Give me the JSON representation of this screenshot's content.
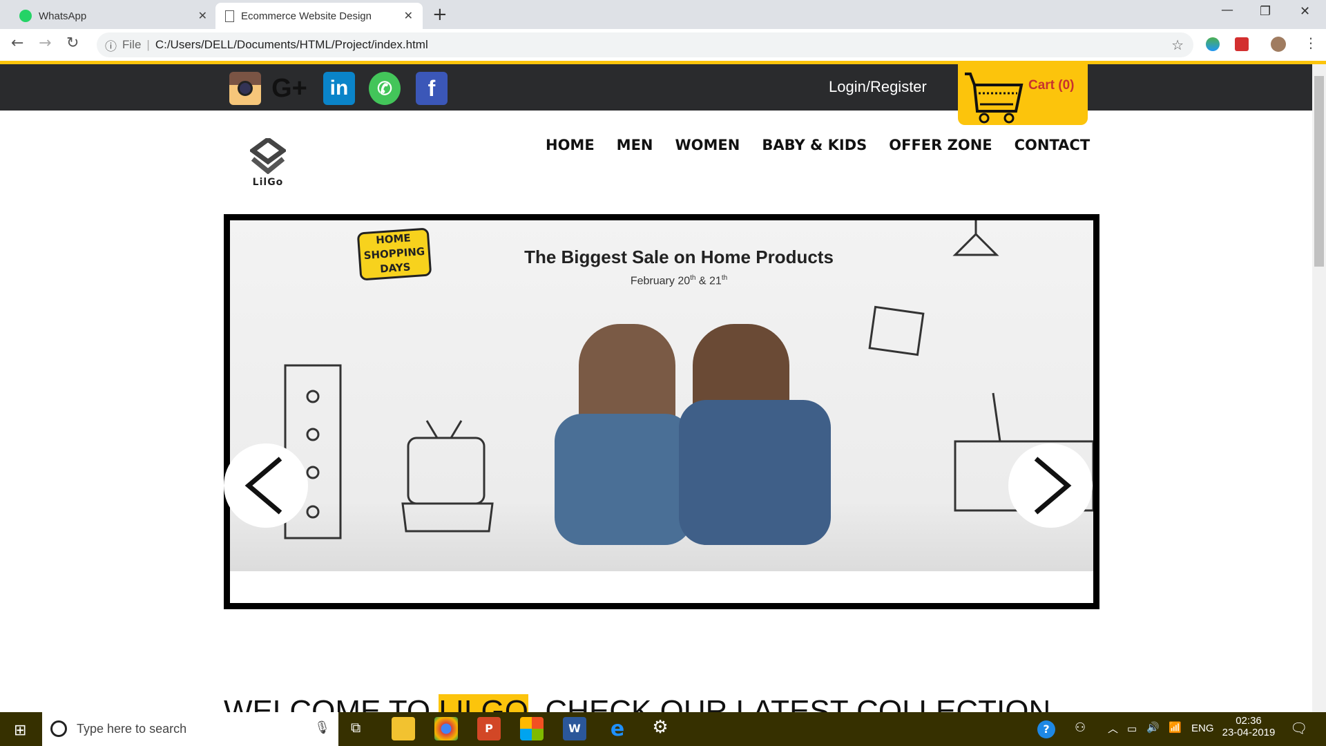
{
  "browser": {
    "tabs": [
      {
        "title": "WhatsApp",
        "icon": "whatsapp-icon"
      },
      {
        "title": "Ecommerce Website Design",
        "icon": "page-icon",
        "active": true
      }
    ],
    "address_prefix": "File",
    "url": "C:/Users/DELL/Documents/HTML/Project/index.html"
  },
  "header": {
    "social": [
      "instagram",
      "google-plus",
      "linkedin",
      "whatsapp",
      "facebook"
    ],
    "login": "Login/Register",
    "cart": "Cart (0)"
  },
  "logo": {
    "text": "LilGo"
  },
  "nav": [
    "HOME",
    "MEN",
    "WOMEN",
    "BABY & KIDS",
    "OFFER ZONE",
    "CONTACT"
  ],
  "banner": {
    "badge": [
      "HOME",
      "SHOPPING",
      "DAYS"
    ],
    "title": "The Biggest Sale on Home Products",
    "date_pre": "February 20",
    "sup1": "th",
    "date_mid": " & 21",
    "sup2": "th"
  },
  "welcome": {
    "pre": "WELCOME TO ",
    "highlight": "LILGO",
    "post": ", CHECK OUR LATEST COLLECTION"
  },
  "taskbar": {
    "search_placeholder": "Type here to search",
    "lang": "ENG",
    "time": "02:36",
    "date": "23-04-2019"
  },
  "colors": {
    "accent": "#fcc40c",
    "header_bg": "#2a2b2d",
    "cart_text": "#c8322e",
    "taskbar": "#363000"
  }
}
